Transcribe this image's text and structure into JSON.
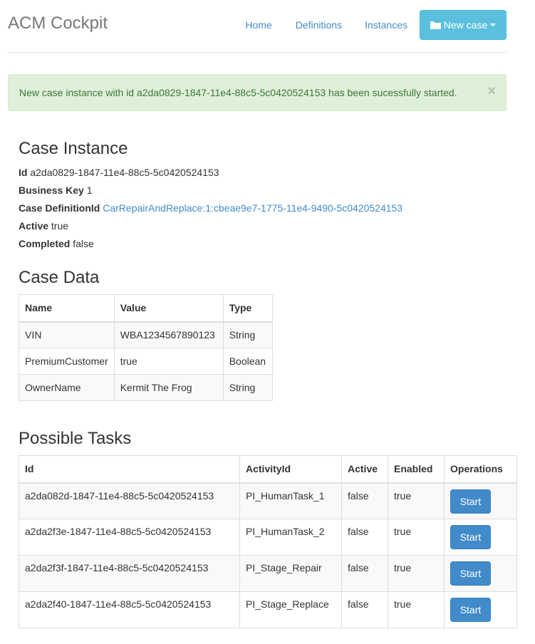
{
  "header": {
    "brand": "ACM Cockpit",
    "nav": [
      "Home",
      "Definitions",
      "Instances"
    ],
    "new_case_label": "New case"
  },
  "alert": {
    "message": "New case instance with id a2da0829-1847-11e4-88c5-5c0420524153 has been sucessfully started.",
    "close": "×"
  },
  "case_instance": {
    "title": "Case Instance",
    "fields": [
      {
        "label": "Id",
        "value": "a2da0829-1847-11e4-88c5-5c0420524153"
      },
      {
        "label": "Business Key",
        "value": "1"
      },
      {
        "label": "Case DefinitionId",
        "value": "CarRepairAndReplace:1:cbeae9e7-1775-11e4-9490-5c0420524153"
      },
      {
        "label": "Active",
        "value": "true"
      },
      {
        "label": "Completed",
        "value": "false"
      }
    ]
  },
  "case_data": {
    "title": "Case Data",
    "columns": [
      "Name",
      "Value",
      "Type"
    ],
    "rows": [
      [
        "VIN",
        "WBA1234567890123",
        "String"
      ],
      [
        "PremiumCustomer",
        "true",
        "Boolean"
      ],
      [
        "OwnerName",
        "Kermit The Frog",
        "String"
      ]
    ]
  },
  "possible_tasks": {
    "title": "Possible Tasks",
    "columns": [
      "Id",
      "ActivityId",
      "Active",
      "Enabled",
      "Operations"
    ],
    "start_label": "Start",
    "rows": [
      [
        "a2da082d-1847-11e4-88c5-5c0420524153",
        "PI_HumanTask_1",
        "false",
        "true"
      ],
      [
        "a2da2f3e-1847-11e4-88c5-5c0420524153",
        "PI_HumanTask_2",
        "false",
        "true"
      ],
      [
        "a2da2f3f-1847-11e4-88c5-5c0420524153",
        "PI_Stage_Repair",
        "false",
        "true"
      ],
      [
        "a2da2f40-1847-11e4-88c5-5c0420524153",
        "PI_Stage_Replace",
        "false",
        "true"
      ]
    ]
  },
  "colors": {
    "link": "#428bca",
    "info_button": "#5bc0de",
    "primary_button": "#428bca",
    "alert_bg": "#dff0d8",
    "alert_text": "#3c763d"
  }
}
